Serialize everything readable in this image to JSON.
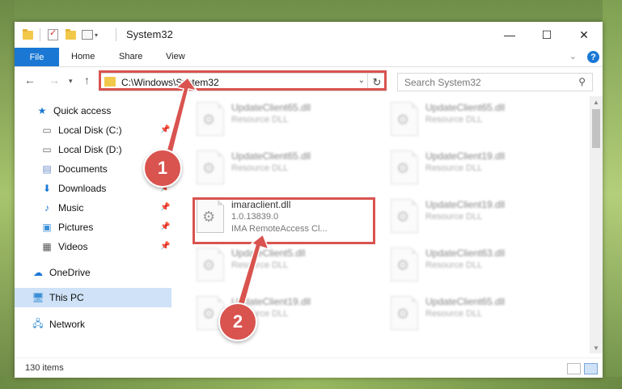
{
  "window": {
    "title": "System32",
    "controls": {
      "minimize": "—",
      "maximize": "☐",
      "close": "✕"
    }
  },
  "ribbon": {
    "tabs": [
      "File",
      "Home",
      "Share",
      "View"
    ],
    "help_label": "?"
  },
  "address_bar": {
    "path": "C:\\Windows\\System32"
  },
  "search": {
    "placeholder": "Search System32"
  },
  "nav_pane": {
    "items": [
      {
        "label": "Quick access",
        "icon": "star-icon"
      },
      {
        "label": "Local Disk (C:)",
        "icon": "drive-icon",
        "pinned": true
      },
      {
        "label": "Local Disk (D:)",
        "icon": "drive-icon"
      },
      {
        "label": "Documents",
        "icon": "documents-icon",
        "pinned": true
      },
      {
        "label": "Downloads",
        "icon": "download-icon",
        "pinned": true
      },
      {
        "label": "Music",
        "icon": "music-icon",
        "pinned": true
      },
      {
        "label": "Pictures",
        "icon": "pictures-icon",
        "pinned": true
      },
      {
        "label": "Videos",
        "icon": "videos-icon",
        "pinned": true
      },
      {
        "label": "OneDrive",
        "icon": "cloud-icon"
      },
      {
        "label": "This PC",
        "icon": "computer-icon",
        "selected": true
      },
      {
        "label": "Network",
        "icon": "network-icon"
      }
    ]
  },
  "files": {
    "left_col": [
      {
        "name": "UpdateClient65.dll",
        "desc": "Resource DLL"
      },
      {
        "name": "UpdateClient65.dll",
        "desc": "Resource DLL"
      },
      {
        "name": "imaraclient.dll",
        "version": "1.0.13839.0",
        "desc": "IMA RemoteAccess Cl..."
      },
      {
        "name": "UpdateClient5.dll",
        "desc": "Resource DLL"
      },
      {
        "name": "UpdateClient19.dll",
        "desc": "Resource DLL"
      }
    ],
    "right_col": [
      {
        "name": "UpdateClient65.dll",
        "desc": "Resource DLL"
      },
      {
        "name": "UpdateClient19.dll",
        "desc": "Resource DLL"
      },
      {
        "name": "UpdateClient19.dll",
        "desc": "Resource DLL"
      },
      {
        "name": "UpdateClient63.dll",
        "desc": "Resource DLL"
      },
      {
        "name": "UpdateClient65.dll",
        "desc": "Resource DLL"
      }
    ]
  },
  "status": {
    "item_count": "130 items"
  },
  "annotations": {
    "step1": "1",
    "step2": "2",
    "color": "#d9534f"
  }
}
